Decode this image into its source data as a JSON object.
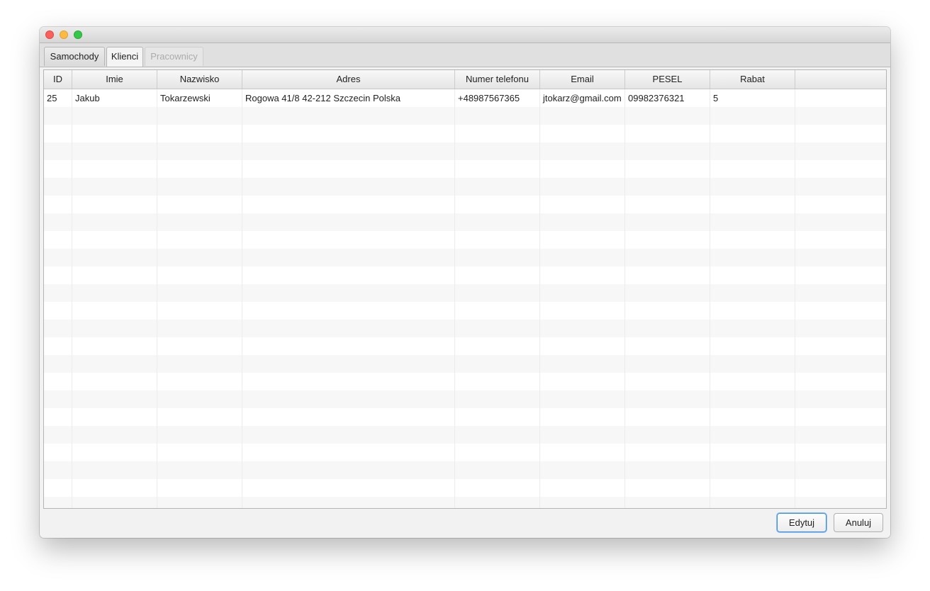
{
  "tabs": [
    {
      "label": "Samochody"
    },
    {
      "label": "Klienci"
    },
    {
      "label": "Pracownicy"
    }
  ],
  "table": {
    "columns": [
      "ID",
      "Imie",
      "Nazwisko",
      "Adres",
      "Numer telefonu",
      "Email",
      "PESEL",
      "Rabat"
    ],
    "rows": [
      [
        "25",
        "Jakub",
        "Tokarzewski",
        "Rogowa 41/8 42-212 Szczecin Polska",
        "+48987567365",
        "jtokarz@gmail.com",
        "09982376321",
        "5"
      ]
    ]
  },
  "buttons": {
    "edit_label": "Edytuj",
    "cancel_label": "Anuluj"
  },
  "colors": {
    "accent": "#3d8ee6",
    "close": "#fc605c",
    "minimize": "#fdbc40",
    "maximize": "#34c84a"
  }
}
